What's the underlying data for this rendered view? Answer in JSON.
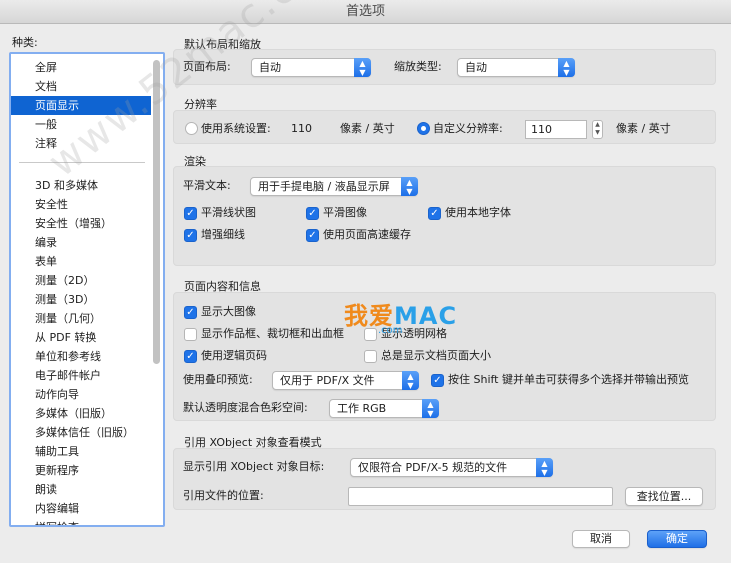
{
  "window": {
    "title": "首选项"
  },
  "categories": {
    "label": "种类:",
    "group1": [
      "全屏",
      "文档",
      "页面显示",
      "一般",
      "注释"
    ],
    "group2": [
      "3D 和多媒体",
      "安全性",
      "安全性（增强）",
      "编录",
      "表单",
      "测量（2D）",
      "测量（3D）",
      "测量（几何）",
      "从 PDF 转换",
      "单位和参考线",
      "电子邮件帐户",
      "动作向导",
      "多媒体（旧版）",
      "多媒体信任（旧版）",
      "辅助工具",
      "更新程序",
      "朗读",
      "内容编辑",
      "拼写检查"
    ],
    "selected": "页面显示"
  },
  "layout": {
    "title": "默认布局和缩放",
    "page_layout_label": "页面布局:",
    "page_layout_value": "自动",
    "zoom_label": "缩放类型:",
    "zoom_value": "自动"
  },
  "resolution": {
    "title": "分辨率",
    "system_label": "使用系统设置:",
    "system_value": "110",
    "system_unit": "像素 / 英寸",
    "custom_label": "自定义分辨率:",
    "custom_value": "110",
    "custom_unit": "像素 / 英寸",
    "selected": "custom"
  },
  "rendering": {
    "title": "渲染",
    "smooth_text_label": "平滑文本:",
    "smooth_text_value": "用于手提电脑 / 液晶显示屏",
    "smooth_line_art": "平滑线状图",
    "smooth_images": "平滑图像",
    "use_local_fonts": "使用本地字体",
    "enhance_thin_lines": "增强细线",
    "use_page_cache": "使用页面高速缓存"
  },
  "page_content": {
    "title": "页面内容和信息",
    "show_large_images": "显示大图像",
    "show_art_trim_bleed": "显示作品框、裁切框和出血框",
    "show_transparency_grid": "显示透明网格",
    "use_logical_page_numbers": "使用逻辑页码",
    "always_show_doc_page_size": "总是显示文档页面大小",
    "overprint_label": "使用叠印预览:",
    "overprint_value": "仅用于 PDF/X 文件",
    "shift_key_hint": "按住 Shift 键并单击可获得多个选择并带输出预览",
    "blend_space_label": "默认透明度混合色彩空间:",
    "blend_space_value": "工作 RGB"
  },
  "xobject": {
    "title": "引用 XObject 对象查看模式",
    "target_label": "显示引用 XObject 对象目标:",
    "target_value": "仅限符合 PDF/X-5 规范的文件",
    "location_label": "引用文件的位置:",
    "location_value": "",
    "browse_button": "查找位置..."
  },
  "footer": {
    "cancel": "取消",
    "ok": "确定"
  },
  "watermarks": {
    "diagonal": "www.52mac.com",
    "brand_cn": "我爱",
    "brand_mac": "MAC",
    "url": ".com"
  },
  "icons": {
    "popup_arrows": "updown-chevron-icon",
    "check": "checkmark-icon"
  }
}
